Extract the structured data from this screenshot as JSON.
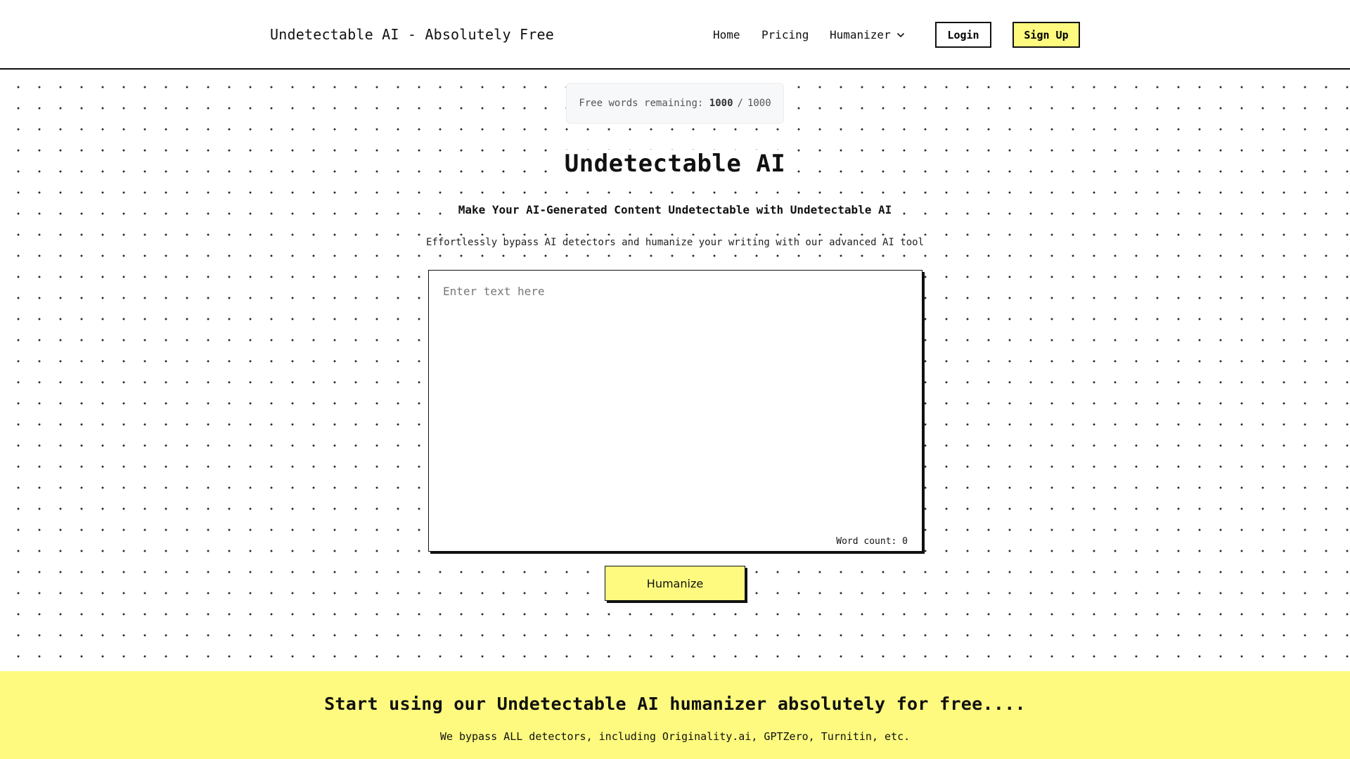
{
  "header": {
    "brand": "Undetectable AI - Absolutely Free",
    "nav": {
      "home": "Home",
      "pricing": "Pricing",
      "humanizer": "Humanizer"
    },
    "login_label": "Login",
    "signup_label": "Sign Up"
  },
  "quota": {
    "label": "Free words remaining:",
    "remaining": "1000",
    "separator": "/",
    "total": "1000"
  },
  "hero": {
    "title": "Undetectable AI",
    "subtitle": "Make Your AI-Generated Content Undetectable with Undetectable AI",
    "tagline": "Effortlessly bypass AI detectors and humanize your writing with our advanced AI tool"
  },
  "editor": {
    "value": "",
    "placeholder": "Enter text here",
    "word_count_label": "Word count:",
    "word_count": "0"
  },
  "humanize_label": "Humanize",
  "cta": {
    "title": "Start using our Undetectable AI humanizer absolutely for free....",
    "subtitle": "We bypass ALL detectors, including Originality.ai, GPTZero, Turnitin, etc."
  },
  "icons": {
    "humanizer_dropdown": "chevron-down-icon"
  },
  "colors": {
    "accent_yellow": "#fdfa7f",
    "ink": "#111111",
    "pill_background": "#f7f8fa"
  }
}
